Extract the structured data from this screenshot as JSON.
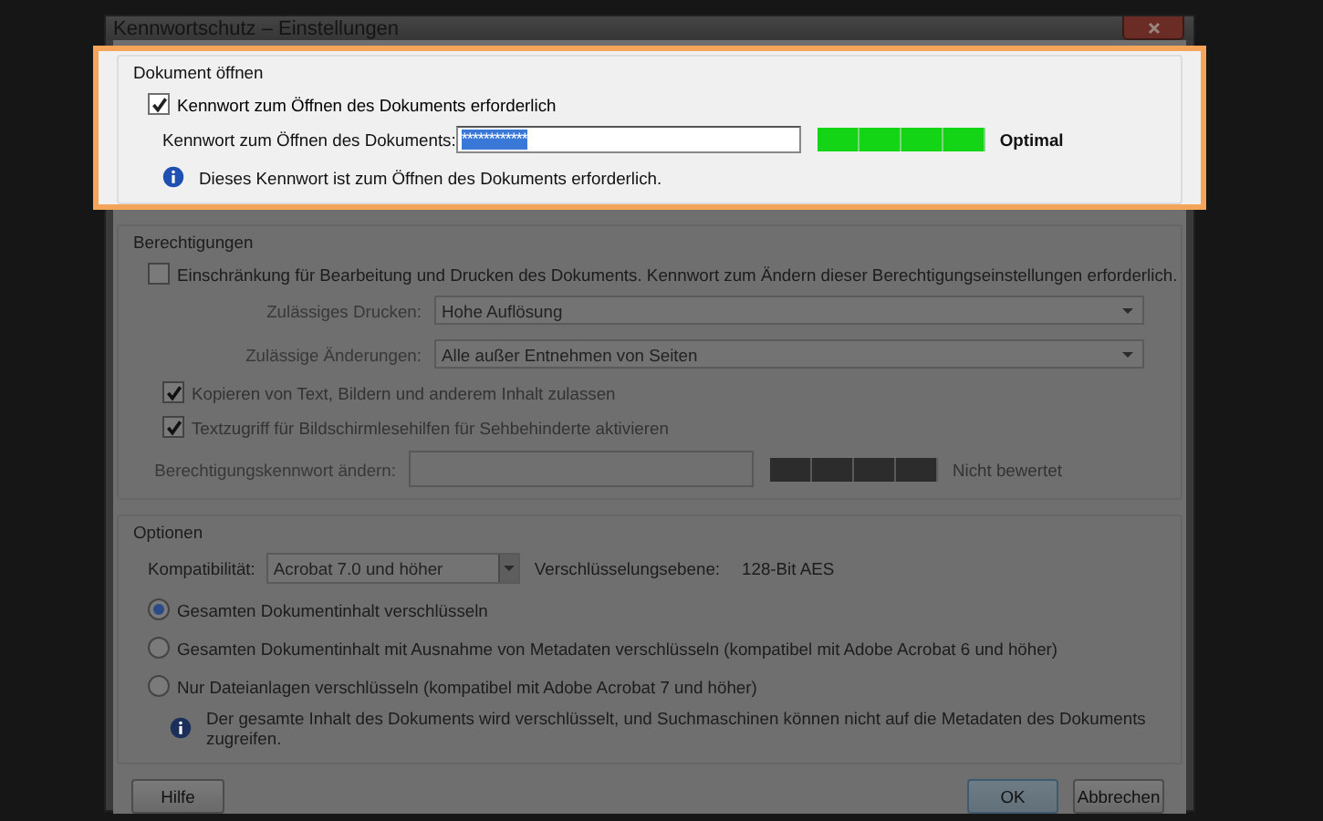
{
  "window": {
    "title": "Kennwortschutz – Einstellungen"
  },
  "open_section": {
    "title": "Dokument öffnen",
    "highlighted": true,
    "require_password": {
      "label": "Kennwort zum Öffnen des Dokuments erforderlich",
      "checked": true
    },
    "password_label": "Kennwort zum Öffnen des Dokuments:",
    "password_value": "************",
    "strength": {
      "level": 1,
      "label": "Optimal"
    },
    "info": "Dieses Kennwort ist zum Öffnen des Dokuments erforderlich."
  },
  "permissions": {
    "title": "Berechtigungen",
    "disabled": true,
    "restrict": {
      "label": "Einschränkung für Bearbeitung und Drucken des Dokuments. Kennwort zum Ändern dieser Berechtigungseinstellungen erforderlich.",
      "checked": false
    },
    "selects": [
      {
        "label": "Zulässiges Drucken:",
        "value": "Hohe Auflösung"
      },
      {
        "label": "Zulässige Änderungen:",
        "value": "Alle außer Entnehmen von Seiten"
      }
    ],
    "options": [
      {
        "label": "Kopieren von Text, Bildern und anderem Inhalt zulassen",
        "checked": true
      },
      {
        "label": "Textzugriff für Bildschirmlesehilfen für Sehbehinderte aktivieren",
        "checked": true
      }
    ],
    "password_label": "Berechtigungskennwort ändern:",
    "strength": {
      "level": 0,
      "label": "Nicht bewertet"
    }
  },
  "options": {
    "title": "Optionen",
    "compat_label": "Kompatibilität:",
    "compat_value": "Acrobat 7.0 und höher",
    "encryption_label": "Verschlüsselungsebene:",
    "encryption_value": "128-Bit AES",
    "radios": [
      {
        "label": "Gesamten Dokumentinhalt verschlüsseln",
        "selected": true
      },
      {
        "label": "Gesamten Dokumentinhalt mit Ausnahme von Metadaten verschlüsseln (kompatibel mit Adobe Acrobat 6 und höher)",
        "selected": false
      },
      {
        "label": "Nur Dateianlagen verschlüsseln (kompatibel mit Adobe Acrobat 7 und höher)",
        "selected": false
      }
    ],
    "info": "Der gesamte Inhalt des Dokuments wird verschlüsselt, und Suchmaschinen können nicht auf die Metadaten des Dokuments zugreifen."
  },
  "buttons": [
    {
      "kind": "help",
      "label": "Hilfe"
    },
    {
      "kind": "ok",
      "label": "OK"
    },
    {
      "kind": "cancel",
      "label": "Abbrechen"
    }
  ]
}
